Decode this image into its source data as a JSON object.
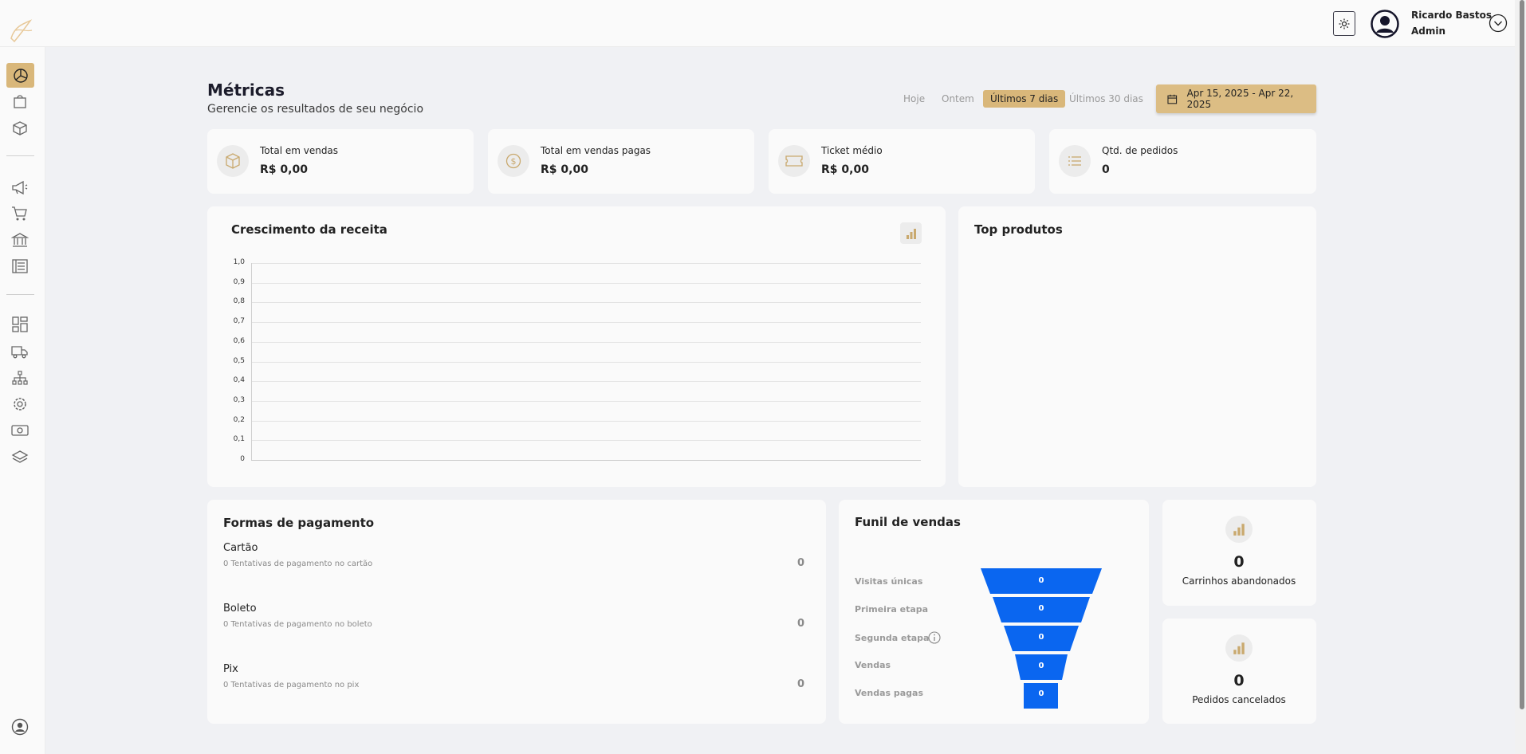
{
  "user": {
    "name": "Ricardo Bastos",
    "role": "Admin"
  },
  "page": {
    "title": "Métricas",
    "subtitle": "Gerencie os resultados de seu negócio"
  },
  "filters": [
    "Hoje",
    "Ontem",
    "Últimos 7 dias",
    "Últimos 30 dias"
  ],
  "active_filter": "Últimos 7 dias",
  "date_range": "Apr 15, 2025 - Apr 22, 2025",
  "stats": [
    {
      "label": "Total em vendas",
      "value": "R$ 0,00",
      "icon": "box-icon"
    },
    {
      "label": "Total em vendas pagas",
      "value": "R$ 0,00",
      "icon": "dollar-icon"
    },
    {
      "label": "Ticket médio",
      "value": "R$ 0,00",
      "icon": "ticket-icon"
    },
    {
      "label": "Qtd. de pedidos",
      "value": "0",
      "icon": "list-icon"
    }
  ],
  "revenue_chart": {
    "title": "Crescimento da receita",
    "y_ticks": [
      "1,0",
      "0,9",
      "0,8",
      "0,7",
      "0,6",
      "0,5",
      "0,4",
      "0,3",
      "0,2",
      "0,1",
      "0"
    ]
  },
  "top_products": {
    "title": "Top produtos"
  },
  "payments": {
    "title": "Formas de pagamento",
    "items": [
      {
        "name": "Cartão",
        "desc": "0 Tentativas de pagamento no cartão",
        "count": "0"
      },
      {
        "name": "Boleto",
        "desc": "0 Tentativas de pagamento no boleto",
        "count": "0"
      },
      {
        "name": "Pix",
        "desc": "0 Tentativas de pagamento no pix",
        "count": "0"
      }
    ]
  },
  "funnel": {
    "title": "Funil de vendas",
    "stages": [
      {
        "label": "Visitas únicas",
        "value": "0"
      },
      {
        "label": "Primeira etapa",
        "value": "0"
      },
      {
        "label": "Segunda etapa",
        "value": "0"
      },
      {
        "label": "Vendas",
        "value": "0"
      },
      {
        "label": "Vendas pagas",
        "value": "0"
      }
    ],
    "color": "#0a66f0"
  },
  "kpis": [
    {
      "value": "0",
      "label": "Carrinhos abandonados"
    },
    {
      "value": "0",
      "label": "Pedidos cancelados"
    }
  ],
  "colors": {
    "accent": "#d9b77a",
    "background": "#f0f1f4",
    "card": "#fafafa",
    "funnel": "#0a66f0"
  }
}
